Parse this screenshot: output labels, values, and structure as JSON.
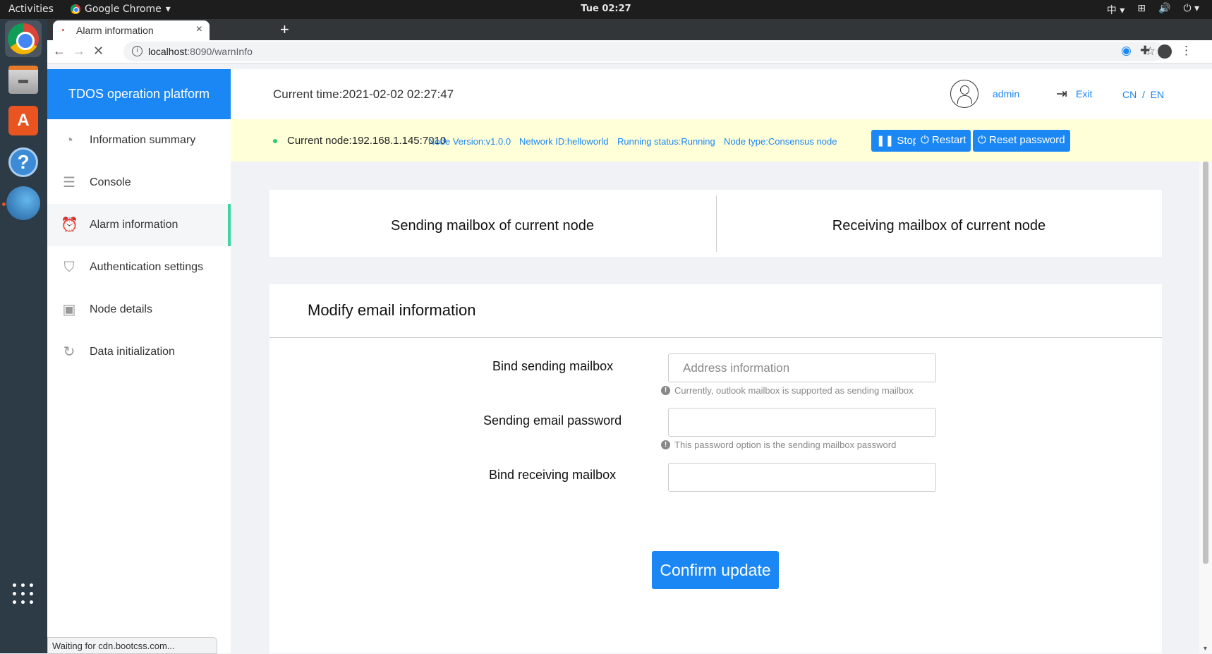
{
  "desktop": {
    "activities": "Activities",
    "app_name": "Google Chrome",
    "clock": "Tue 02:27",
    "input_method": "中"
  },
  "browser": {
    "tab_title": "Alarm information",
    "url_host": "localhost",
    "url_path": ":8090/warnInfo",
    "status": "Waiting for cdn.bootcss.com..."
  },
  "sidebar": {
    "brand": "TDOS operation platform",
    "items": [
      {
        "label": "Information summary",
        "icon": "dashboard-icon"
      },
      {
        "label": "Console",
        "icon": "sliders-icon"
      },
      {
        "label": "Alarm information",
        "icon": "alarm-icon",
        "active": true
      },
      {
        "label": "Authentication settings",
        "icon": "shield-icon"
      },
      {
        "label": "Node details",
        "icon": "chart-icon"
      },
      {
        "label": "Data initialization",
        "icon": "reset-icon"
      }
    ]
  },
  "header": {
    "time": "Current time:2021-02-02 02:27:47",
    "user": "admin",
    "exit": "Exit",
    "lang": "CN  /  EN"
  },
  "nodebar": {
    "current_node": "Current node:192.168.1.145:7010",
    "version": "Node Version:v1.0.0",
    "network": "Network ID:helloworld",
    "status": "Running status:Running",
    "type": "Node type:Consensus node",
    "stop": "Stop",
    "restart": "Restart",
    "reset": "Reset password"
  },
  "tabs": {
    "sending": "Sending mailbox of current node",
    "receiving": "Receiving mailbox of current node"
  },
  "form": {
    "title": "Modify email information",
    "bind_sending_label": "Bind sending mailbox",
    "bind_sending_placeholder": "Address information",
    "bind_sending_hint": "Currently, outlook mailbox is supported as sending mailbox",
    "password_label": "Sending email password",
    "password_hint": "This password option is the sending mailbox password",
    "bind_receiving_label": "Bind receiving mailbox",
    "confirm": "Confirm update"
  },
  "colors": {
    "primary": "#1a87f5",
    "active_indicator": "#3cd6a0",
    "nodebar_bg": "#ffffd8"
  }
}
